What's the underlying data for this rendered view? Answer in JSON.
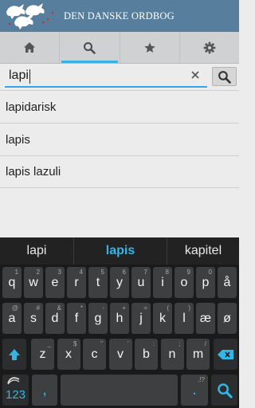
{
  "header": {
    "title": "DEN DANSKE ORDBOG"
  },
  "tabs": [
    {
      "icon": "home-icon",
      "active": false
    },
    {
      "icon": "search-icon",
      "active": true
    },
    {
      "icon": "star-icon",
      "active": false
    },
    {
      "icon": "gear-icon",
      "active": false
    }
  ],
  "search": {
    "value": "lapi"
  },
  "results": [
    "lapidarisk",
    "lapis",
    "lapis lazuli"
  ],
  "keyboard": {
    "suggestions": [
      "lapi",
      "lapis",
      "kapitel"
    ],
    "row1": [
      {
        "k": "q",
        "h": "1"
      },
      {
        "k": "w",
        "h": "2"
      },
      {
        "k": "e",
        "h": "3"
      },
      {
        "k": "r",
        "h": "4"
      },
      {
        "k": "t",
        "h": "5"
      },
      {
        "k": "y",
        "h": "6"
      },
      {
        "k": "u",
        "h": "7"
      },
      {
        "k": "i",
        "h": "8"
      },
      {
        "k": "o",
        "h": "9"
      },
      {
        "k": "p",
        "h": "0"
      },
      {
        "k": "å",
        "h": ""
      }
    ],
    "row2": [
      {
        "k": "a",
        "h": "@"
      },
      {
        "k": "s",
        "h": "#"
      },
      {
        "k": "d",
        "h": "&"
      },
      {
        "k": "f",
        "h": "*"
      },
      {
        "k": "g",
        "h": "-"
      },
      {
        "k": "h",
        "h": "+"
      },
      {
        "k": "j",
        "h": "="
      },
      {
        "k": "k",
        "h": "("
      },
      {
        "k": "l",
        "h": ")"
      },
      {
        "k": "æ",
        "h": ""
      },
      {
        "k": "ø",
        "h": ""
      }
    ],
    "row3": [
      {
        "k": "z",
        "h": "_"
      },
      {
        "k": "x",
        "h": "$"
      },
      {
        "k": "c",
        "h": "\""
      },
      {
        "k": "v",
        "h": "'"
      },
      {
        "k": "b",
        "h": ":"
      },
      {
        "k": "n",
        "h": ";"
      },
      {
        "k": "m",
        "h": "/"
      }
    ],
    "num_label": "123",
    "comma": ",",
    "period": ".",
    "period_hint": ",!?"
  },
  "colors": {
    "header": "#577e9d",
    "accent": "#33b5e5"
  }
}
